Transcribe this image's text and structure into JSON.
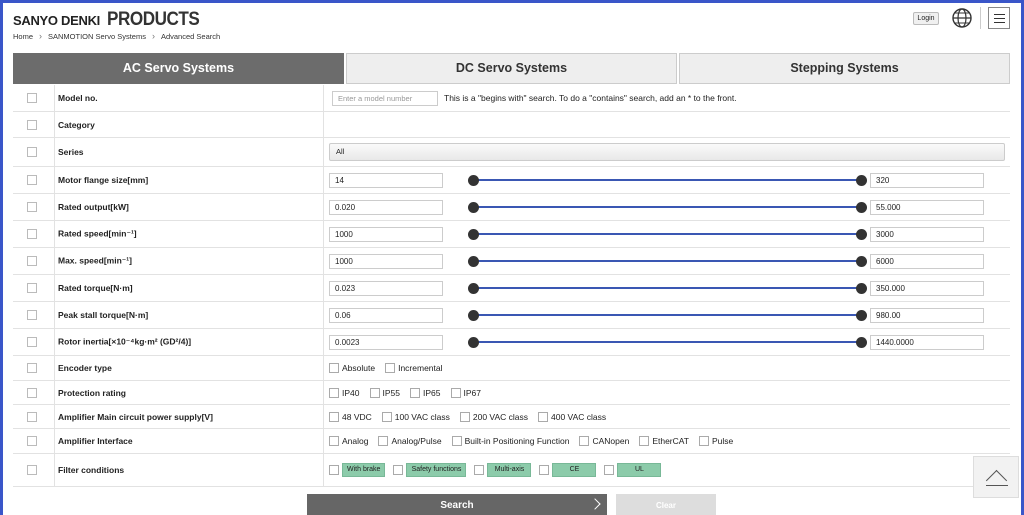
{
  "header": {
    "logo_brand": "SANYO DENKI",
    "logo_products": "PRODUCTS",
    "breadcrumb": [
      "Home",
      "SANMOTION Servo Systems",
      "Advanced Search"
    ],
    "login_label": "Login"
  },
  "tabs": [
    {
      "label": "AC Servo Systems",
      "active": true
    },
    {
      "label": "DC Servo Systems",
      "active": false
    },
    {
      "label": "Stepping Systems",
      "active": false
    }
  ],
  "model": {
    "label": "Model no.",
    "placeholder": "Enter a model number",
    "note": "This is a \"begins with\" search. To do a \"contains\" search, add an * to the front."
  },
  "category": {
    "label": "Category"
  },
  "series": {
    "label": "Series",
    "value": "All"
  },
  "ranges": [
    {
      "label": "Motor flange size[mm]",
      "min": "14",
      "max": "320"
    },
    {
      "label": "Rated output[kW]",
      "min": "0.020",
      "max": "55.000"
    },
    {
      "label": "Rated speed[min⁻¹]",
      "min": "1000",
      "max": "3000"
    },
    {
      "label": "Max. speed[min⁻¹]",
      "min": "1000",
      "max": "6000"
    },
    {
      "label": "Rated torque[N·m]",
      "min": "0.023",
      "max": "350.000"
    },
    {
      "label": "Peak stall torque[N·m]",
      "min": "0.06",
      "max": "980.00"
    },
    {
      "label": "Rotor inertia[×10⁻⁴kg·m² (GD²/4)]",
      "min": "0.0023",
      "max": "1440.0000"
    }
  ],
  "encoder": {
    "label": "Encoder type",
    "options": [
      "Absolute",
      "Incremental"
    ]
  },
  "protection": {
    "label": "Protection rating",
    "options": [
      "IP40",
      "IP55",
      "IP65",
      "IP67"
    ]
  },
  "power": {
    "label": "Amplifier Main circuit power supply[V]",
    "options": [
      "48 VDC",
      "100 VAC class",
      "200 VAC class",
      "400 VAC class"
    ]
  },
  "interface": {
    "label": "Amplifier Interface",
    "options": [
      "Analog",
      "Analog/Pulse",
      "Built-in Positioning Function",
      "CANopen",
      "EtherCAT",
      "Pulse"
    ]
  },
  "filter": {
    "label": "Filter conditions",
    "options": [
      "With brake",
      "Safety functions",
      "Multi-axis",
      "CE",
      "UL"
    ]
  },
  "buttons": {
    "search": "Search",
    "clear": "Clear"
  },
  "colors": {
    "accent": "#3a57b3",
    "chip": "#8ccbaa",
    "tab_active": "#6c6c6c"
  }
}
